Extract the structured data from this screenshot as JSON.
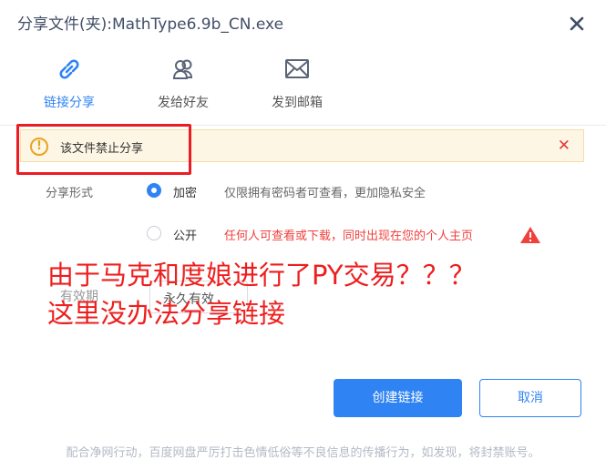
{
  "dialog": {
    "title": "分享文件(夹):MathType6.9b_CN.exe"
  },
  "tabs": [
    {
      "label": "链接分享",
      "icon": "link-icon",
      "active": true
    },
    {
      "label": "发给好友",
      "icon": "friends-icon",
      "active": false
    },
    {
      "label": "发到邮箱",
      "icon": "mail-icon",
      "active": false
    }
  ],
  "warning": {
    "icon": "exclamation-icon",
    "text": "该文件禁止分享"
  },
  "share_form": {
    "label": "分享形式",
    "options": [
      {
        "label": "加密",
        "desc": "仅限拥有密码者可查看，更加隐私安全",
        "selected": true
      },
      {
        "label": "公开",
        "desc": "任何人可查看或下载，同时出现在您的个人主页",
        "selected": false
      }
    ]
  },
  "validity": {
    "label": "有效期",
    "value": "永久有效"
  },
  "annotation": {
    "line1": "由于马克和度娘进行了PY交易？？？",
    "line2": "这里没办法分享链接"
  },
  "buttons": {
    "create": "创建链接",
    "cancel": "取消"
  },
  "footer": "配合净网行动，百度网盘严厉打击色情低俗等不良信息的传播行为，如发现，将封禁账号。",
  "colors": {
    "accent": "#2f83f3",
    "warning_bg": "#fdf6e4",
    "error_red": "#e6393a",
    "annotation_red": "#ee1e1e"
  }
}
